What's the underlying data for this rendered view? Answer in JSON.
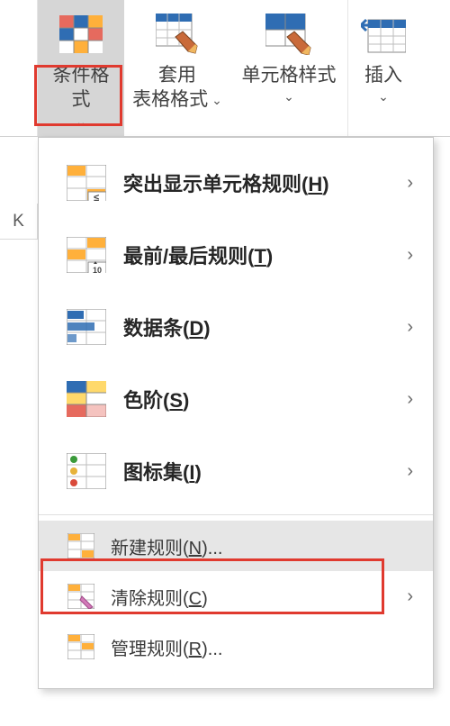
{
  "ribbon": {
    "conditional_formatting": "条件格式",
    "format_as_table_top": "套用",
    "format_as_table_bottom": "表格格式",
    "cell_styles": "单元格样式",
    "insert": "插入"
  },
  "cell_label": "K",
  "menu": {
    "highlight_cells": {
      "text": "突出显示单元格规则(",
      "key": "H",
      "suffix": ")"
    },
    "top_bottom": {
      "text": "最前/最后规则(",
      "key": "T",
      "suffix": ")"
    },
    "data_bars": {
      "text": "数据条(",
      "key": "D",
      "suffix": ")"
    },
    "color_scales": {
      "text": "色阶(",
      "key": "S",
      "suffix": ")"
    },
    "icon_sets": {
      "text": "图标集(",
      "key": "I",
      "suffix": ")"
    },
    "new_rule": {
      "text": "新建规则(",
      "key": "N",
      "suffix": ")..."
    },
    "clear_rules": {
      "text": "清除规则(",
      "key": "C",
      "suffix": ")"
    },
    "manage_rules": {
      "text": "管理规则(",
      "key": "R",
      "suffix": ")..."
    }
  }
}
